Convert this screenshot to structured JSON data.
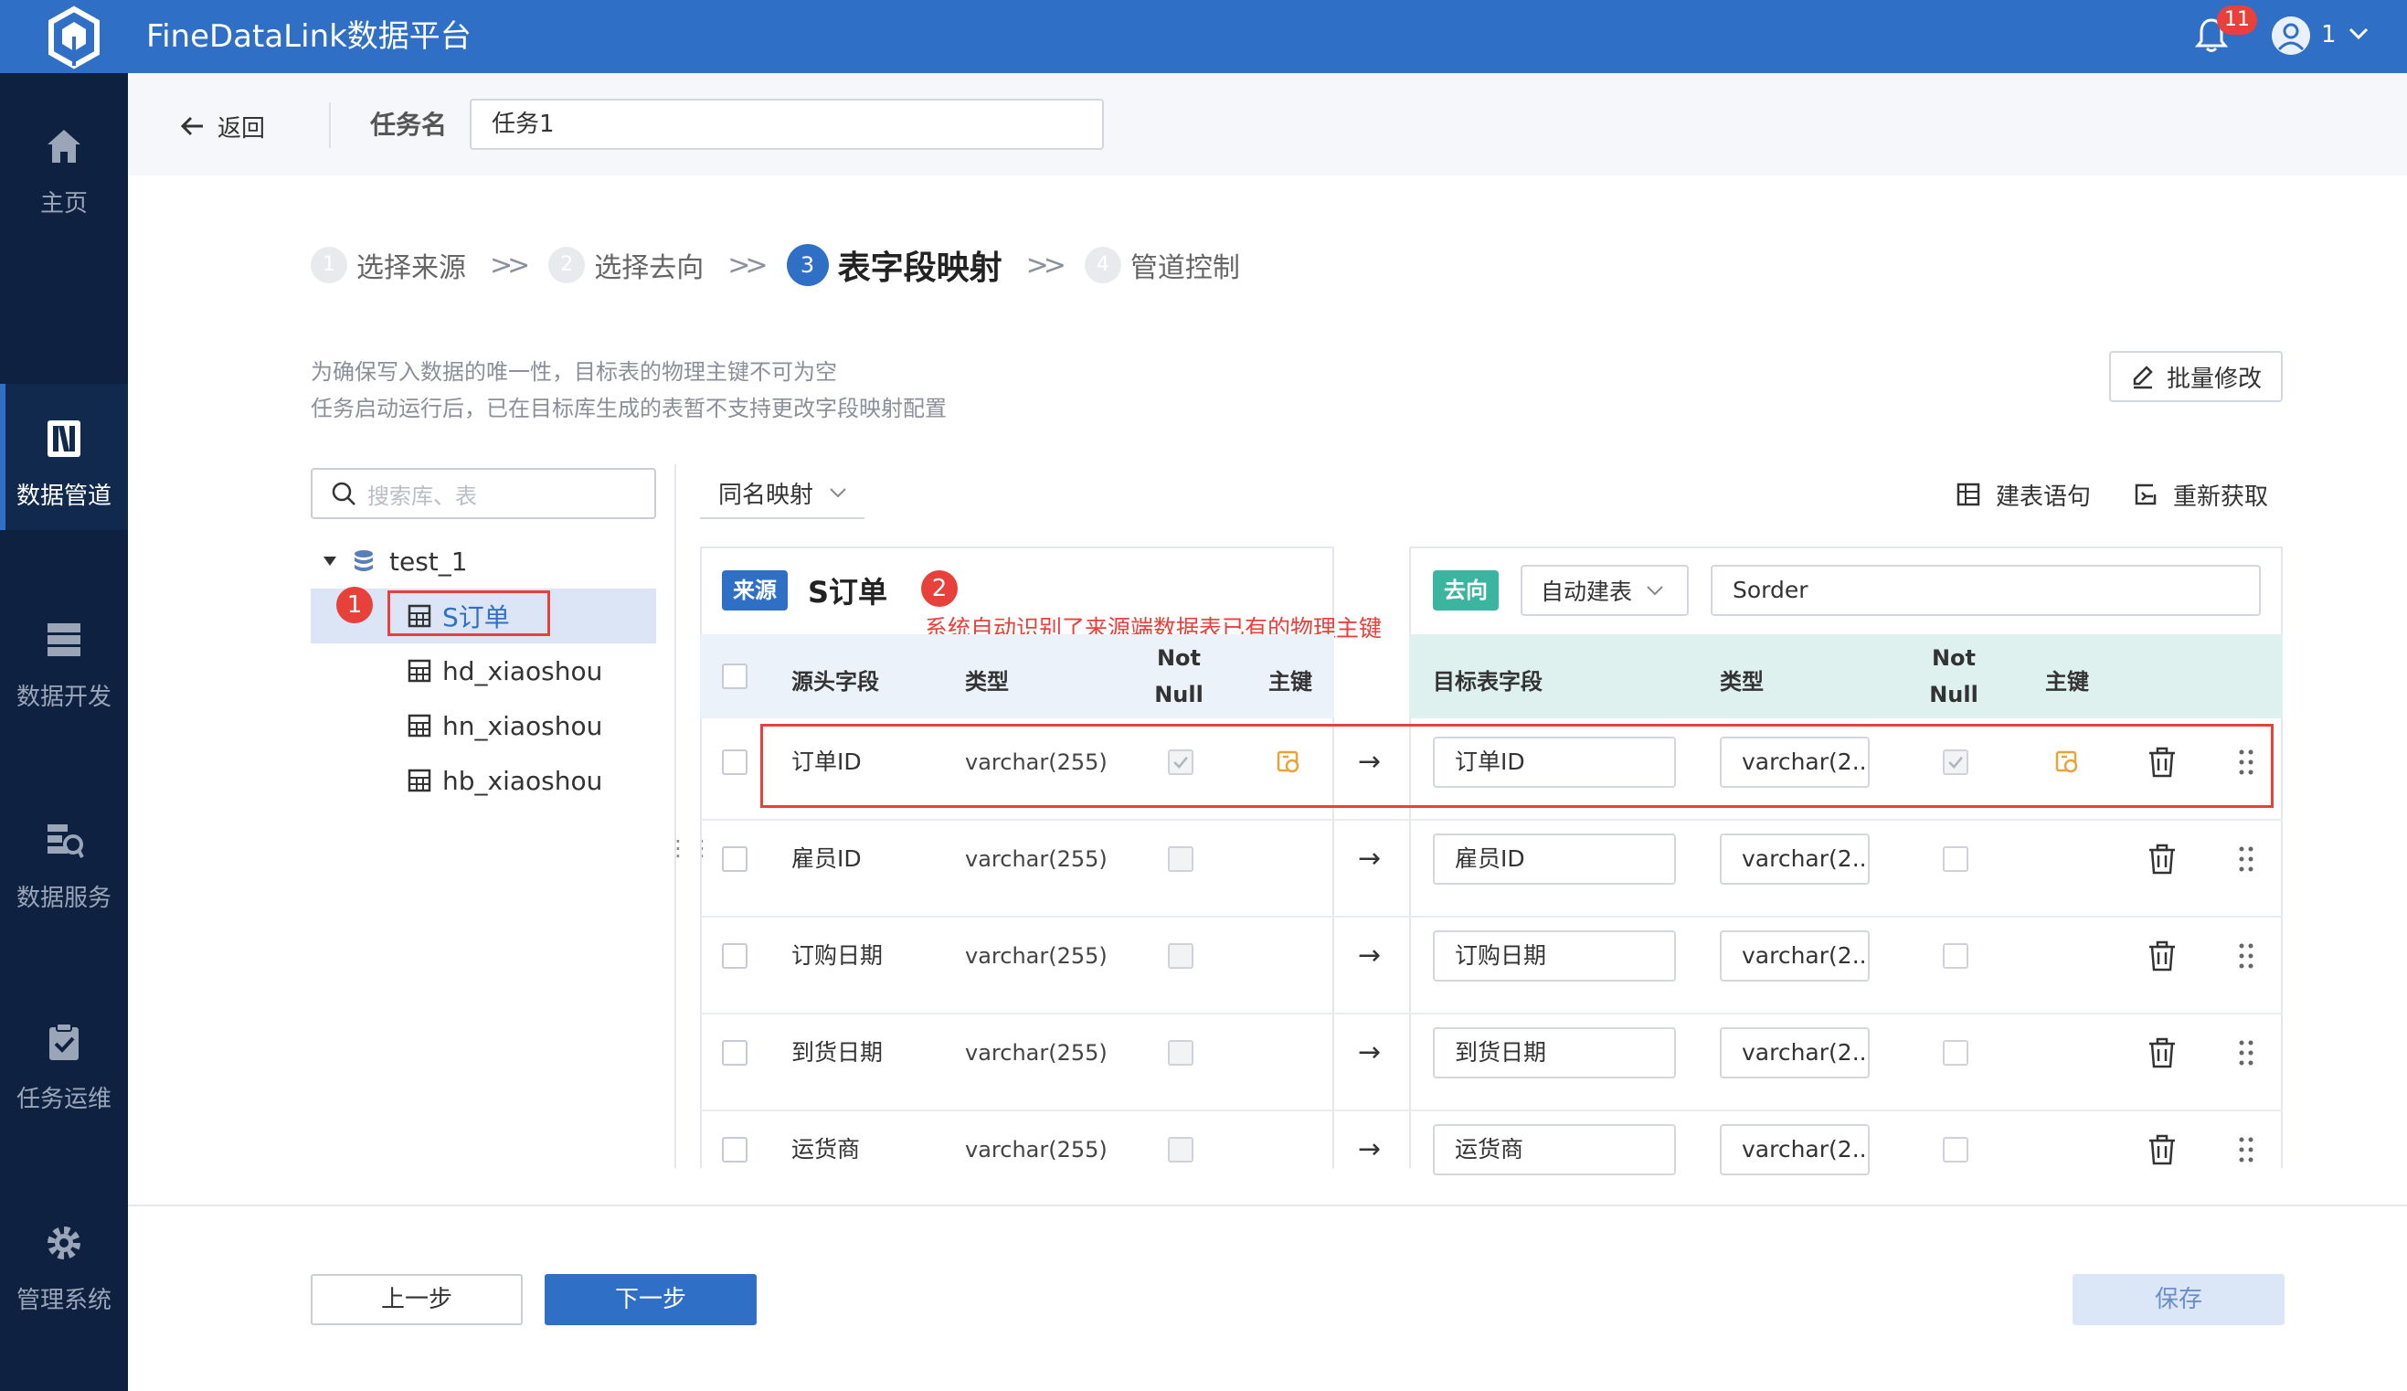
{
  "app": {
    "title": "FineDataLink数据平台",
    "notifications": "11",
    "user": "1",
    "accent_color": "#2f6fc5",
    "sidebar_bg": "#0f2140"
  },
  "sidebar": {
    "items": [
      {
        "label": "主页",
        "icon": "home-icon"
      },
      {
        "label": "数据管道",
        "icon": "pipeline-icon",
        "active": true
      },
      {
        "label": "数据开发",
        "icon": "server-icon"
      },
      {
        "label": "数据服务",
        "icon": "service-icon"
      },
      {
        "label": "任务运维",
        "icon": "clipboard-check-icon"
      },
      {
        "label": "管理系统",
        "icon": "gear-icon"
      }
    ]
  },
  "header": {
    "back_label": "返回",
    "task_label": "任务名",
    "task_value": "任务1"
  },
  "steps": [
    {
      "num": "1",
      "label": "选择来源"
    },
    {
      "num": "2",
      "label": "选择去向"
    },
    {
      "num": "3",
      "label": "表字段映射",
      "active": true
    },
    {
      "num": "4",
      "label": "管道控制"
    }
  ],
  "notes": {
    "line1": "为确保写入数据的唯一性，目标表的物理主键不可为空",
    "line2": "任务启动运行后，已在目标库生成的表暂不支持更改字段映射配置"
  },
  "toolbar": {
    "batch_edit": "批量修改",
    "mapping_mode": "同名映射",
    "create_sql": "建表语句",
    "refetch": "重新获取"
  },
  "tree": {
    "search_placeholder": "搜索库、表",
    "database": "test_1",
    "tables": [
      "S订单",
      "hd_xiaoshou",
      "hn_xiaoshou",
      "hb_xiaoshou"
    ],
    "selected": "S订单"
  },
  "annotations": {
    "badge1": "1",
    "badge2": "2",
    "text2": "系统自动识别了来源端数据表已有的物理主键"
  },
  "source": {
    "tag": "来源",
    "table": "S订单",
    "columns": {
      "field": "源头字段",
      "type": "类型",
      "not_null_1": "Not",
      "not_null_2": "Null",
      "pk": "主键"
    }
  },
  "target": {
    "tag": "去向",
    "mode": "自动建表",
    "table": "Sorder",
    "columns": {
      "field": "目标表字段",
      "type": "类型",
      "not_null_1": "Not",
      "not_null_2": "Null",
      "pk": "主键"
    }
  },
  "rows": [
    {
      "src_field": "订单ID",
      "src_type": "varchar(255)",
      "src_not_null": true,
      "src_pk": true,
      "tgt_field": "订单ID",
      "tgt_type": "varchar(2...",
      "tgt_not_null": true,
      "tgt_pk": true
    },
    {
      "src_field": "雇员ID",
      "src_type": "varchar(255)",
      "src_not_null": false,
      "src_pk": false,
      "tgt_field": "雇员ID",
      "tgt_type": "varchar(2...",
      "tgt_not_null": false,
      "tgt_pk": false
    },
    {
      "src_field": "订购日期",
      "src_type": "varchar(255)",
      "src_not_null": false,
      "src_pk": false,
      "tgt_field": "订购日期",
      "tgt_type": "varchar(2...",
      "tgt_not_null": false,
      "tgt_pk": false
    },
    {
      "src_field": "到货日期",
      "src_type": "varchar(255)",
      "src_not_null": false,
      "src_pk": false,
      "tgt_field": "到货日期",
      "tgt_type": "varchar(2...",
      "tgt_not_null": false,
      "tgt_pk": false
    },
    {
      "src_field": "运货商",
      "src_type": "varchar(255)",
      "src_not_null": false,
      "src_pk": false,
      "tgt_field": "运货商",
      "tgt_type": "varchar(2...",
      "tgt_not_null": false,
      "tgt_pk": false
    }
  ],
  "footer": {
    "prev": "上一步",
    "next": "下一步",
    "save": "保存"
  }
}
